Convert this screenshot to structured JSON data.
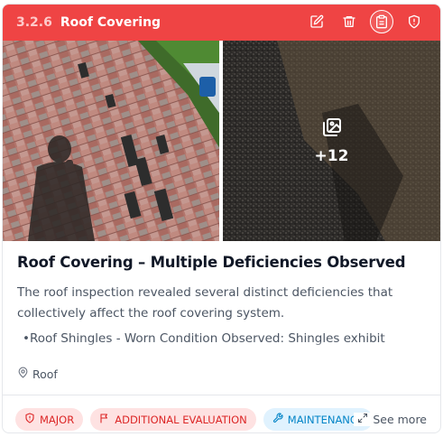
{
  "header": {
    "section_number": "3.2.6",
    "section_title": "Roof Covering",
    "icons": [
      "edit-icon",
      "trash-icon",
      "clipboard-icon",
      "shield-alert-icon"
    ],
    "color": "#ef4444"
  },
  "gallery": {
    "more_count": "+12",
    "icon": "image-gallery-icon"
  },
  "content": {
    "title": "Roof Covering – Multiple Deficiencies Observed",
    "description": "The roof inspection revealed several distinct deficiencies that collectively affect the roof covering system.",
    "bullets": [
      "Roof Shingles - Worn Condition Observed: Shingles exhibit significant weathering, loss of granules and surface cracking"
    ],
    "location": "Roof"
  },
  "tags": [
    {
      "label": "MAJOR",
      "icon": "shield-alert-icon",
      "color": "#dc2626"
    },
    {
      "label": "ADDITIONAL EVALUATION",
      "icon": "flag-icon",
      "color": "#dc2626"
    },
    {
      "label": "MAINTENANCE",
      "icon": "wrench-icon",
      "color": "#0284c7"
    }
  ],
  "footer": {
    "see_more_label": "See more"
  }
}
